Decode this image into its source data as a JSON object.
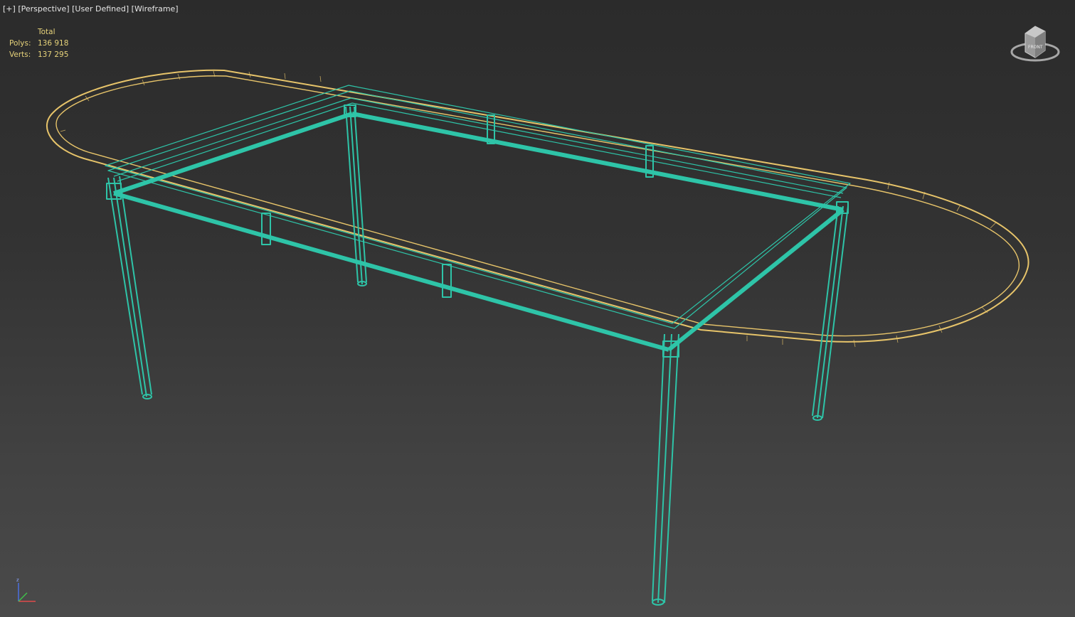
{
  "viewport": {
    "menu_plus": "[+]",
    "view_name": "[Perspective]",
    "shading_mode": "[User Defined]",
    "display_mode": "[Wireframe]"
  },
  "stats": {
    "header": "Total",
    "polys_label": "Polys:",
    "polys_value": "136 918",
    "verts_label": "Verts:",
    "verts_value": "137 295"
  },
  "viewcube": {
    "face_label": "FRONT"
  },
  "axis": {
    "z_label": "z"
  },
  "colors": {
    "frame": "#2ec4a8",
    "tabletop": "#e7c46a",
    "stats_text": "#e6d27a",
    "label_text": "#e6e6e6"
  },
  "icons": [
    "viewcube-icon",
    "axis-tripod-icon"
  ]
}
